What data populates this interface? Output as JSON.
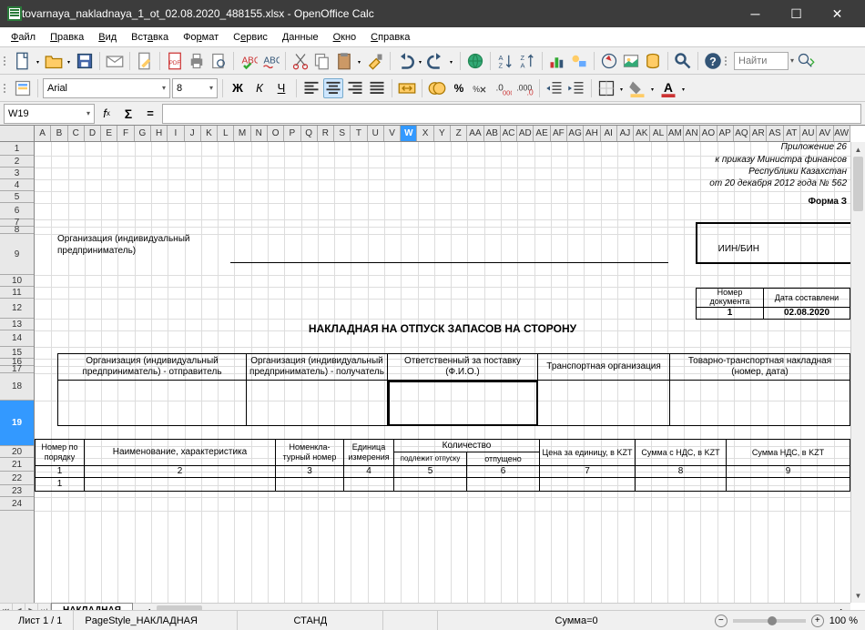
{
  "window": {
    "title": "tovarnaya_nakladnaya_1_ot_02.08.2020_488155.xlsx - OpenOffice Calc"
  },
  "menu": {
    "items": [
      "Файл",
      "Правка",
      "Вид",
      "Вставка",
      "Формат",
      "Сервис",
      "Данные",
      "Окно",
      "Справка"
    ]
  },
  "toolbar": {
    "find_placeholder": "Найти"
  },
  "format": {
    "font_name": "Arial",
    "font_size": "8"
  },
  "formula": {
    "cell_ref": "W19",
    "value": ""
  },
  "columns": [
    "A",
    "B",
    "C",
    "D",
    "E",
    "F",
    "G",
    "H",
    "I",
    "J",
    "K",
    "L",
    "M",
    "N",
    "O",
    "P",
    "Q",
    "R",
    "S",
    "T",
    "U",
    "V",
    "W",
    "X",
    "Y",
    "Z",
    "AA",
    "AB",
    "AC",
    "AD",
    "AE",
    "AF",
    "AG",
    "AH",
    "AI",
    "AJ",
    "AK",
    "AL",
    "AM",
    "AN",
    "AO",
    "AP",
    "AQ",
    "AR",
    "AS",
    "AT",
    "AU",
    "AV",
    "AW"
  ],
  "selected_col": "W",
  "rows": [
    1,
    2,
    3,
    4,
    5,
    6,
    7,
    8,
    9,
    10,
    11,
    12,
    13,
    14,
    15,
    16,
    17,
    18,
    19,
    20,
    21,
    22,
    23,
    24
  ],
  "selected_row": 19,
  "row_heights": {
    "1": 15,
    "2": 13,
    "3": 13,
    "4": 13,
    "5": 13,
    "6": 18,
    "7": 8,
    "8": 8,
    "9": 45,
    "10": 13,
    "11": 13,
    "12": 22,
    "13": 13,
    "14": 18,
    "15": 13,
    "16": 8,
    "17": 8,
    "18": 30,
    "19": 50,
    "20": 13,
    "21": 15,
    "22": 15,
    "23": 13,
    "24": 15
  },
  "doc": {
    "annex": "Приложение 26",
    "order1": "к приказу Министра финансов",
    "order2": "Республики Казахстан",
    "order3": "от 20 декабря 2012 года № 562",
    "form": "Форма З",
    "org_label": "Организация (индивидуальный предприниматель)",
    "iin": "ИИН/БИН",
    "doc_num_label": "Номер документа",
    "doc_num": "1",
    "date_label": "Дата составлени",
    "date": "02.08.2020",
    "title": "НАКЛАДНАЯ НА ОТПУСК ЗАПАСОВ НА СТОРОНУ",
    "h1": "Организация (индивидуальный предприниматель) - отправитель",
    "h2": "Организация (индивидуальный предприниматель) - получатель",
    "h3": "Ответственный за поставку (Ф.И.О.)",
    "h4": "Транспортная организация",
    "h5": "Товарно-транспортная накладная (номер, дата)",
    "t_num": "Номер по порядку",
    "t_name": "Наименование, характеристика",
    "t_nom": "Номенкла-турный номер",
    "t_unit": "Единица измерения",
    "t_qty": "Количество",
    "t_qty1": "подлежит отпуску",
    "t_qty2": "отпущено",
    "t_price": "Цена за единицу, в KZT",
    "t_sum": "Сумма с НДС, в KZT",
    "t_nds": "Сумма НДС, в KZT",
    "cols": [
      "1",
      "2",
      "3",
      "4",
      "5",
      "6",
      "7",
      "8",
      "9"
    ],
    "row1": "1"
  },
  "tabs": {
    "sheet": "НАКЛАДНАЯ"
  },
  "status": {
    "sheet": "Лист 1 / 1",
    "style": "PageStyle_НАКЛАДНАЯ",
    "mode": "СТАНД",
    "sum": "Сумма=0",
    "zoom": "100 %"
  },
  "chart_data": null
}
